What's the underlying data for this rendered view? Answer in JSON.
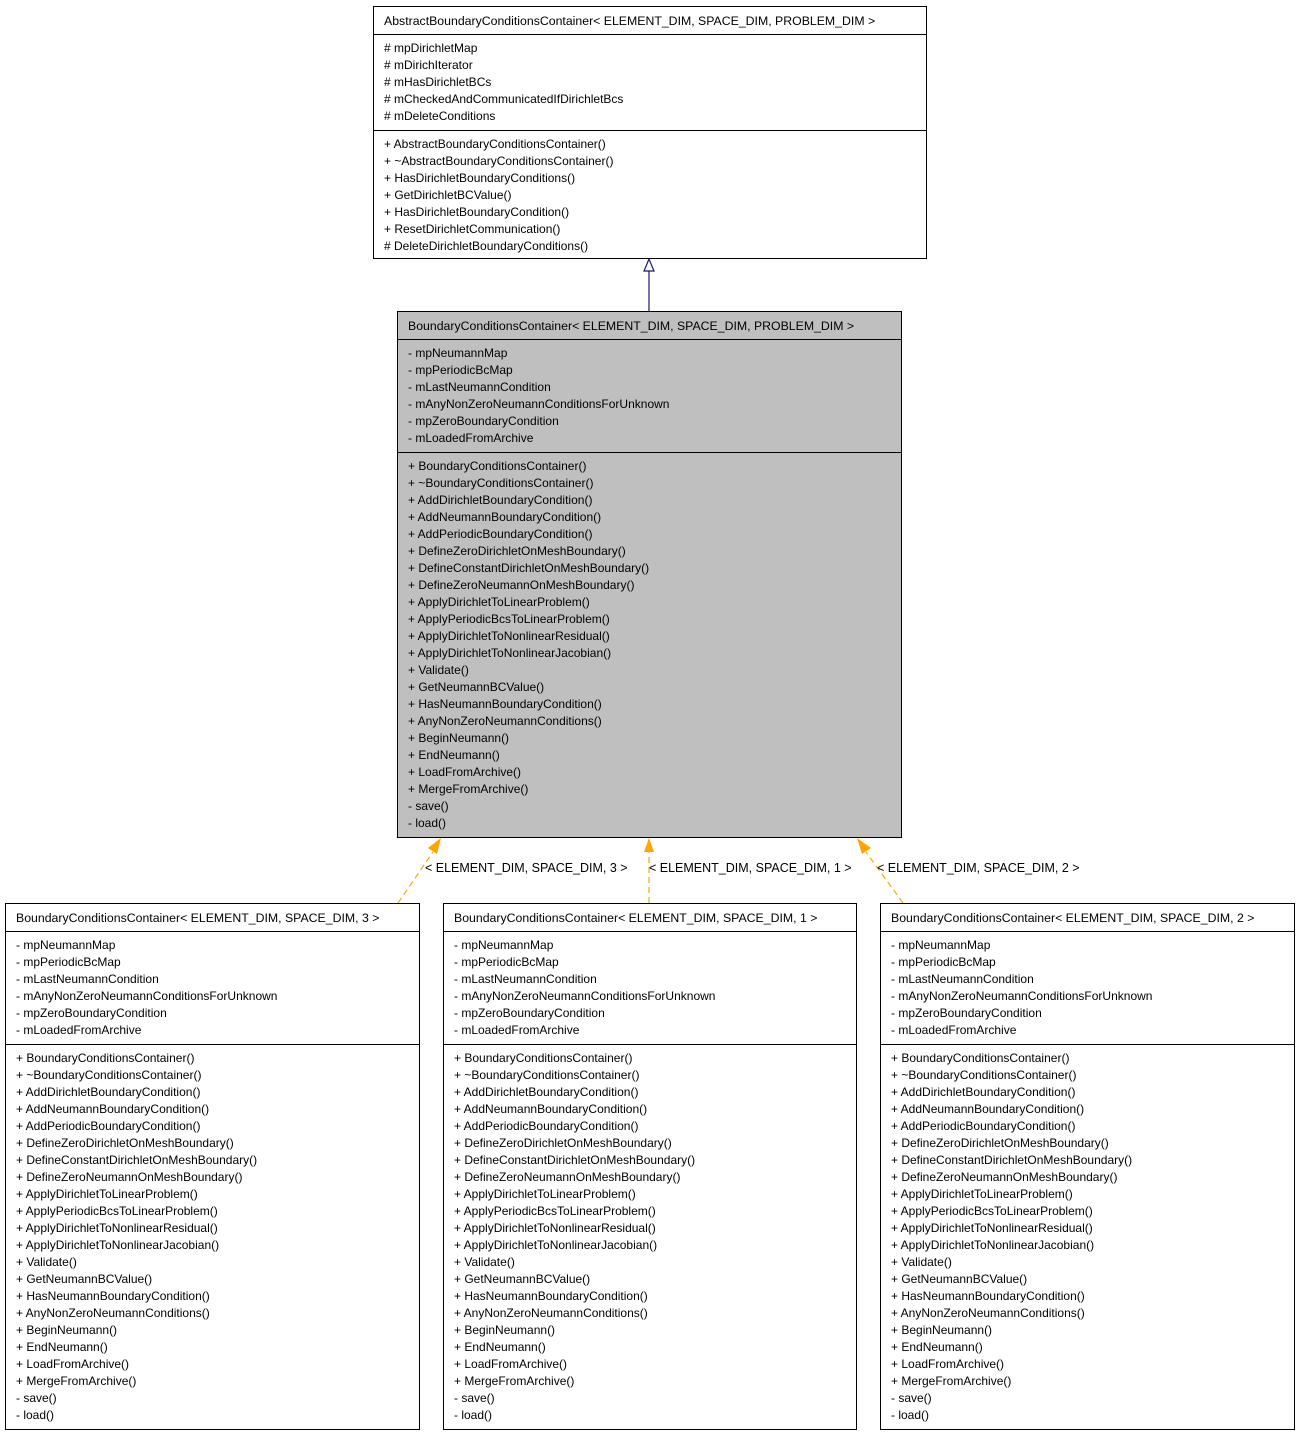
{
  "diagram": {
    "type": "uml-class-inheritance",
    "colors": {
      "focus_fill": "#bfbfbf",
      "inheritance_edge": "#191970",
      "template_edge": "#ffa500",
      "border": "#000000"
    },
    "base_class": {
      "name": "AbstractBoundaryConditionsContainer< ELEMENT_DIM, SPACE_DIM, PROBLEM_DIM >",
      "attributes": [
        "# mpDirichletMap",
        "# mDirichIterator",
        "# mHasDirichletBCs",
        "# mCheckedAndCommunicatedIfDirichletBcs",
        "# mDeleteConditions"
      ],
      "methods": [
        "+ AbstractBoundaryConditionsContainer()",
        "+ ~AbstractBoundaryConditionsContainer()",
        "+ HasDirichletBoundaryConditions()",
        "+ GetDirichletBCValue()",
        "+ HasDirichletBoundaryCondition()",
        "+ ResetDirichletCommunication()",
        "# DeleteDirichletBoundaryConditions()"
      ]
    },
    "focus_class": {
      "name": "BoundaryConditionsContainer< ELEMENT_DIM, SPACE_DIM, PROBLEM_DIM >",
      "attributes": [
        "- mpNeumannMap",
        "- mpPeriodicBcMap",
        "- mLastNeumannCondition",
        "- mAnyNonZeroNeumannConditionsForUnknown",
        "- mpZeroBoundaryCondition",
        "- mLoadedFromArchive"
      ],
      "methods": [
        "+ BoundaryConditionsContainer()",
        "+ ~BoundaryConditionsContainer()",
        "+ AddDirichletBoundaryCondition()",
        "+ AddNeumannBoundaryCondition()",
        "+ AddPeriodicBoundaryCondition()",
        "+ DefineZeroDirichletOnMeshBoundary()",
        "+ DefineConstantDirichletOnMeshBoundary()",
        "+ DefineZeroNeumannOnMeshBoundary()",
        "+ ApplyDirichletToLinearProblem()",
        "+ ApplyPeriodicBcsToLinearProblem()",
        "+ ApplyDirichletToNonlinearResidual()",
        "+ ApplyDirichletToNonlinearJacobian()",
        "+ Validate()",
        "+ GetNeumannBCValue()",
        "+ HasNeumannBoundaryCondition()",
        "+ AnyNonZeroNeumannConditions()",
        "+ BeginNeumann()",
        "+ EndNeumann()",
        "+ LoadFromArchive()",
        "+ MergeFromArchive()",
        "- save()",
        "- load()"
      ]
    },
    "specializations": [
      {
        "name": "BoundaryConditionsContainer< ELEMENT_DIM, SPACE_DIM, 3 >",
        "edge_label": "< ELEMENT_DIM, SPACE_DIM, 3 >",
        "attributes": [
          "- mpNeumannMap",
          "- mpPeriodicBcMap",
          "- mLastNeumannCondition",
          "- mAnyNonZeroNeumannConditionsForUnknown",
          "- mpZeroBoundaryCondition",
          "- mLoadedFromArchive"
        ],
        "methods": [
          "+ BoundaryConditionsContainer()",
          "+ ~BoundaryConditionsContainer()",
          "+ AddDirichletBoundaryCondition()",
          "+ AddNeumannBoundaryCondition()",
          "+ AddPeriodicBoundaryCondition()",
          "+ DefineZeroDirichletOnMeshBoundary()",
          "+ DefineConstantDirichletOnMeshBoundary()",
          "+ DefineZeroNeumannOnMeshBoundary()",
          "+ ApplyDirichletToLinearProblem()",
          "+ ApplyPeriodicBcsToLinearProblem()",
          "+ ApplyDirichletToNonlinearResidual()",
          "+ ApplyDirichletToNonlinearJacobian()",
          "+ Validate()",
          "+ GetNeumannBCValue()",
          "+ HasNeumannBoundaryCondition()",
          "+ AnyNonZeroNeumannConditions()",
          "+ BeginNeumann()",
          "+ EndNeumann()",
          "+ LoadFromArchive()",
          "+ MergeFromArchive()",
          "- save()",
          "- load()"
        ]
      },
      {
        "name": "BoundaryConditionsContainer< ELEMENT_DIM, SPACE_DIM, 1 >",
        "edge_label": "< ELEMENT_DIM, SPACE_DIM, 1 >",
        "attributes": [
          "- mpNeumannMap",
          "- mpPeriodicBcMap",
          "- mLastNeumannCondition",
          "- mAnyNonZeroNeumannConditionsForUnknown",
          "- mpZeroBoundaryCondition",
          "- mLoadedFromArchive"
        ],
        "methods": [
          "+ BoundaryConditionsContainer()",
          "+ ~BoundaryConditionsContainer()",
          "+ AddDirichletBoundaryCondition()",
          "+ AddNeumannBoundaryCondition()",
          "+ AddPeriodicBoundaryCondition()",
          "+ DefineZeroDirichletOnMeshBoundary()",
          "+ DefineConstantDirichletOnMeshBoundary()",
          "+ DefineZeroNeumannOnMeshBoundary()",
          "+ ApplyDirichletToLinearProblem()",
          "+ ApplyPeriodicBcsToLinearProblem()",
          "+ ApplyDirichletToNonlinearResidual()",
          "+ ApplyDirichletToNonlinearJacobian()",
          "+ Validate()",
          "+ GetNeumannBCValue()",
          "+ HasNeumannBoundaryCondition()",
          "+ AnyNonZeroNeumannConditions()",
          "+ BeginNeumann()",
          "+ EndNeumann()",
          "+ LoadFromArchive()",
          "+ MergeFromArchive()",
          "- save()",
          "- load()"
        ]
      },
      {
        "name": "BoundaryConditionsContainer< ELEMENT_DIM, SPACE_DIM, 2 >",
        "edge_label": "< ELEMENT_DIM, SPACE_DIM, 2 >",
        "attributes": [
          "- mpNeumannMap",
          "- mpPeriodicBcMap",
          "- mLastNeumannCondition",
          "- mAnyNonZeroNeumannConditionsForUnknown",
          "- mpZeroBoundaryCondition",
          "- mLoadedFromArchive"
        ],
        "methods": [
          "+ BoundaryConditionsContainer()",
          "+ ~BoundaryConditionsContainer()",
          "+ AddDirichletBoundaryCondition()",
          "+ AddNeumannBoundaryCondition()",
          "+ AddPeriodicBoundaryCondition()",
          "+ DefineZeroDirichletOnMeshBoundary()",
          "+ DefineConstantDirichletOnMeshBoundary()",
          "+ DefineZeroNeumannOnMeshBoundary()",
          "+ ApplyDirichletToLinearProblem()",
          "+ ApplyPeriodicBcsToLinearProblem()",
          "+ ApplyDirichletToNonlinearResidual()",
          "+ ApplyDirichletToNonlinearJacobian()",
          "+ Validate()",
          "+ GetNeumannBCValue()",
          "+ HasNeumannBoundaryCondition()",
          "+ AnyNonZeroNeumannConditions()",
          "+ BeginNeumann()",
          "+ EndNeumann()",
          "+ LoadFromArchive()",
          "+ MergeFromArchive()",
          "- save()",
          "- load()"
        ]
      }
    ]
  }
}
